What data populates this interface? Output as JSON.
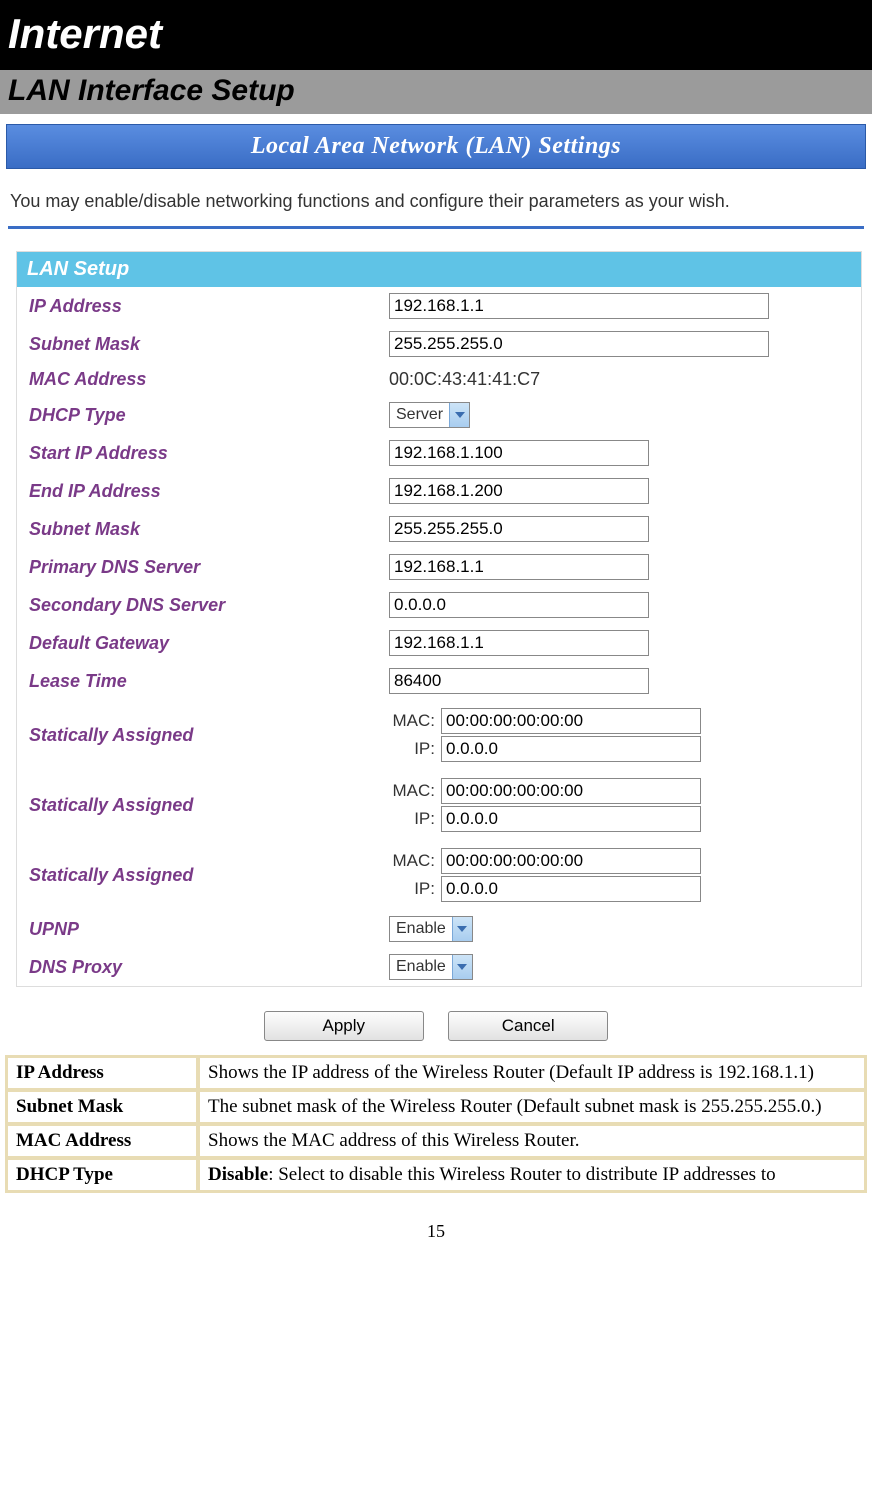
{
  "header": {
    "title": "Internet",
    "subtitle": "LAN Interface Setup"
  },
  "panel": {
    "title": "Local Area Network (LAN) Settings",
    "intro": "You may enable/disable networking functions and configure their parameters as your wish.",
    "section_header": "LAN Setup"
  },
  "fields": {
    "ip_address": {
      "label": "IP Address",
      "value": "192.168.1.1"
    },
    "subnet_mask": {
      "label": "Subnet Mask",
      "value": "255.255.255.0"
    },
    "mac_address": {
      "label": "MAC Address",
      "value": "00:0C:43:41:41:C7"
    },
    "dhcp_type": {
      "label": "DHCP Type",
      "value": "Server"
    },
    "start_ip": {
      "label": "Start IP Address",
      "value": "192.168.1.100"
    },
    "end_ip": {
      "label": "End IP Address",
      "value": "192.168.1.200"
    },
    "subnet_mask2": {
      "label": "Subnet Mask",
      "value": "255.255.255.0"
    },
    "primary_dns": {
      "label": "Primary DNS Server",
      "value": "192.168.1.1"
    },
    "secondary_dns": {
      "label": "Secondary DNS Server",
      "value": "0.0.0.0"
    },
    "default_gateway": {
      "label": "Default Gateway",
      "value": "192.168.1.1"
    },
    "lease_time": {
      "label": "Lease Time",
      "value": "86400"
    },
    "static1": {
      "label": "Statically Assigned",
      "mac_label": "MAC:",
      "mac": "00:00:00:00:00:00",
      "ip_label": "IP:",
      "ip": "0.0.0.0"
    },
    "static2": {
      "label": "Statically Assigned",
      "mac_label": "MAC:",
      "mac": "00:00:00:00:00:00",
      "ip_label": "IP:",
      "ip": "0.0.0.0"
    },
    "static3": {
      "label": "Statically Assigned",
      "mac_label": "MAC:",
      "mac": "00:00:00:00:00:00",
      "ip_label": "IP:",
      "ip": "0.0.0.0"
    },
    "upnp": {
      "label": "UPNP",
      "value": "Enable"
    },
    "dns_proxy": {
      "label": "DNS Proxy",
      "value": "Enable"
    }
  },
  "buttons": {
    "apply": "Apply",
    "cancel": "Cancel"
  },
  "descriptions": {
    "ip_address": {
      "key": "IP Address",
      "text": "Shows the IP address of the Wireless  Router (Default IP address is 192.168.1.1)"
    },
    "subnet_mask": {
      "key": "Subnet Mask",
      "text": "The subnet mask of the Wireless  Router (Default subnet mask is 255.255.255.0.)"
    },
    "mac_address": {
      "key": "MAC Address",
      "text": "Shows the MAC address of this Wireless  Router."
    },
    "dhcp_type": {
      "key": "DHCP Type",
      "bold": "Disable",
      "text": ": Select to disable this Wireless  Router to distribute IP addresses to"
    }
  },
  "page_number": "15"
}
